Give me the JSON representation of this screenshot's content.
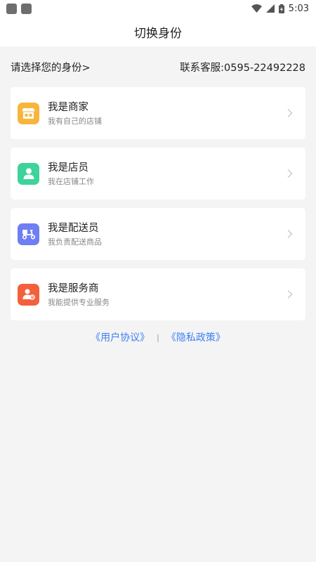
{
  "status_bar": {
    "time": "5:03"
  },
  "header": {
    "title": "切换身份"
  },
  "info": {
    "prompt": "请选择您的身份>",
    "contact": "联系客服:0595-22492228"
  },
  "roles": [
    {
      "title": "我是商家",
      "subtitle": "我有自己的店铺",
      "icon": "store-icon",
      "color": "#f8b53c"
    },
    {
      "title": "我是店员",
      "subtitle": "我在店铺工作",
      "icon": "staff-icon",
      "color": "#3dd39b"
    },
    {
      "title": "我是配送员",
      "subtitle": "我负责配送商品",
      "icon": "delivery-scooter-icon",
      "color": "#6e7ef3"
    },
    {
      "title": "我是服务商",
      "subtitle": "我能提供专业服务",
      "icon": "service-provider-icon",
      "color": "#f4603c"
    }
  ],
  "links": {
    "user_agreement": "《用户协议》",
    "separator": "|",
    "privacy_policy": "《隐私政策》"
  }
}
